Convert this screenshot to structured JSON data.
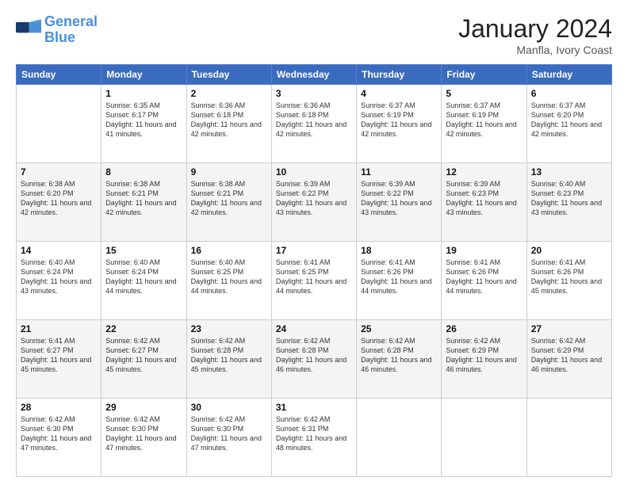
{
  "logo": {
    "line1": "General",
    "line2": "Blue"
  },
  "header": {
    "month": "January 2024",
    "location": "Manfla, Ivory Coast"
  },
  "weekdays": [
    "Sunday",
    "Monday",
    "Tuesday",
    "Wednesday",
    "Thursday",
    "Friday",
    "Saturday"
  ],
  "weeks": [
    [
      {
        "day": "",
        "sunrise": "",
        "sunset": "",
        "daylight": ""
      },
      {
        "day": "1",
        "sunrise": "Sunrise: 6:35 AM",
        "sunset": "Sunset: 6:17 PM",
        "daylight": "Daylight: 11 hours and 41 minutes."
      },
      {
        "day": "2",
        "sunrise": "Sunrise: 6:36 AM",
        "sunset": "Sunset: 6:18 PM",
        "daylight": "Daylight: 11 hours and 42 minutes."
      },
      {
        "day": "3",
        "sunrise": "Sunrise: 6:36 AM",
        "sunset": "Sunset: 6:18 PM",
        "daylight": "Daylight: 11 hours and 42 minutes."
      },
      {
        "day": "4",
        "sunrise": "Sunrise: 6:37 AM",
        "sunset": "Sunset: 6:19 PM",
        "daylight": "Daylight: 11 hours and 42 minutes."
      },
      {
        "day": "5",
        "sunrise": "Sunrise: 6:37 AM",
        "sunset": "Sunset: 6:19 PM",
        "daylight": "Daylight: 11 hours and 42 minutes."
      },
      {
        "day": "6",
        "sunrise": "Sunrise: 6:37 AM",
        "sunset": "Sunset: 6:20 PM",
        "daylight": "Daylight: 11 hours and 42 minutes."
      }
    ],
    [
      {
        "day": "7",
        "sunrise": "Sunrise: 6:38 AM",
        "sunset": "Sunset: 6:20 PM",
        "daylight": "Daylight: 11 hours and 42 minutes."
      },
      {
        "day": "8",
        "sunrise": "Sunrise: 6:38 AM",
        "sunset": "Sunset: 6:21 PM",
        "daylight": "Daylight: 11 hours and 42 minutes."
      },
      {
        "day": "9",
        "sunrise": "Sunrise: 6:38 AM",
        "sunset": "Sunset: 6:21 PM",
        "daylight": "Daylight: 11 hours and 42 minutes."
      },
      {
        "day": "10",
        "sunrise": "Sunrise: 6:39 AM",
        "sunset": "Sunset: 6:22 PM",
        "daylight": "Daylight: 11 hours and 43 minutes."
      },
      {
        "day": "11",
        "sunrise": "Sunrise: 6:39 AM",
        "sunset": "Sunset: 6:22 PM",
        "daylight": "Daylight: 11 hours and 43 minutes."
      },
      {
        "day": "12",
        "sunrise": "Sunrise: 6:39 AM",
        "sunset": "Sunset: 6:23 PM",
        "daylight": "Daylight: 11 hours and 43 minutes."
      },
      {
        "day": "13",
        "sunrise": "Sunrise: 6:40 AM",
        "sunset": "Sunset: 6:23 PM",
        "daylight": "Daylight: 11 hours and 43 minutes."
      }
    ],
    [
      {
        "day": "14",
        "sunrise": "Sunrise: 6:40 AM",
        "sunset": "Sunset: 6:24 PM",
        "daylight": "Daylight: 11 hours and 43 minutes."
      },
      {
        "day": "15",
        "sunrise": "Sunrise: 6:40 AM",
        "sunset": "Sunset: 6:24 PM",
        "daylight": "Daylight: 11 hours and 44 minutes."
      },
      {
        "day": "16",
        "sunrise": "Sunrise: 6:40 AM",
        "sunset": "Sunset: 6:25 PM",
        "daylight": "Daylight: 11 hours and 44 minutes."
      },
      {
        "day": "17",
        "sunrise": "Sunrise: 6:41 AM",
        "sunset": "Sunset: 6:25 PM",
        "daylight": "Daylight: 11 hours and 44 minutes."
      },
      {
        "day": "18",
        "sunrise": "Sunrise: 6:41 AM",
        "sunset": "Sunset: 6:26 PM",
        "daylight": "Daylight: 11 hours and 44 minutes."
      },
      {
        "day": "19",
        "sunrise": "Sunrise: 6:41 AM",
        "sunset": "Sunset: 6:26 PM",
        "daylight": "Daylight: 11 hours and 44 minutes."
      },
      {
        "day": "20",
        "sunrise": "Sunrise: 6:41 AM",
        "sunset": "Sunset: 6:26 PM",
        "daylight": "Daylight: 11 hours and 45 minutes."
      }
    ],
    [
      {
        "day": "21",
        "sunrise": "Sunrise: 6:41 AM",
        "sunset": "Sunset: 6:27 PM",
        "daylight": "Daylight: 11 hours and 45 minutes."
      },
      {
        "day": "22",
        "sunrise": "Sunrise: 6:42 AM",
        "sunset": "Sunset: 6:27 PM",
        "daylight": "Daylight: 11 hours and 45 minutes."
      },
      {
        "day": "23",
        "sunrise": "Sunrise: 6:42 AM",
        "sunset": "Sunset: 6:28 PM",
        "daylight": "Daylight: 11 hours and 45 minutes."
      },
      {
        "day": "24",
        "sunrise": "Sunrise: 6:42 AM",
        "sunset": "Sunset: 6:28 PM",
        "daylight": "Daylight: 11 hours and 46 minutes."
      },
      {
        "day": "25",
        "sunrise": "Sunrise: 6:42 AM",
        "sunset": "Sunset: 6:28 PM",
        "daylight": "Daylight: 11 hours and 46 minutes."
      },
      {
        "day": "26",
        "sunrise": "Sunrise: 6:42 AM",
        "sunset": "Sunset: 6:29 PM",
        "daylight": "Daylight: 11 hours and 46 minutes."
      },
      {
        "day": "27",
        "sunrise": "Sunrise: 6:42 AM",
        "sunset": "Sunset: 6:29 PM",
        "daylight": "Daylight: 11 hours and 46 minutes."
      }
    ],
    [
      {
        "day": "28",
        "sunrise": "Sunrise: 6:42 AM",
        "sunset": "Sunset: 6:30 PM",
        "daylight": "Daylight: 11 hours and 47 minutes."
      },
      {
        "day": "29",
        "sunrise": "Sunrise: 6:42 AM",
        "sunset": "Sunset: 6:30 PM",
        "daylight": "Daylight: 11 hours and 47 minutes."
      },
      {
        "day": "30",
        "sunrise": "Sunrise: 6:42 AM",
        "sunset": "Sunset: 6:30 PM",
        "daylight": "Daylight: 11 hours and 47 minutes."
      },
      {
        "day": "31",
        "sunrise": "Sunrise: 6:42 AM",
        "sunset": "Sunset: 6:31 PM",
        "daylight": "Daylight: 11 hours and 48 minutes."
      },
      {
        "day": "",
        "sunrise": "",
        "sunset": "",
        "daylight": ""
      },
      {
        "day": "",
        "sunrise": "",
        "sunset": "",
        "daylight": ""
      },
      {
        "day": "",
        "sunrise": "",
        "sunset": "",
        "daylight": ""
      }
    ]
  ]
}
